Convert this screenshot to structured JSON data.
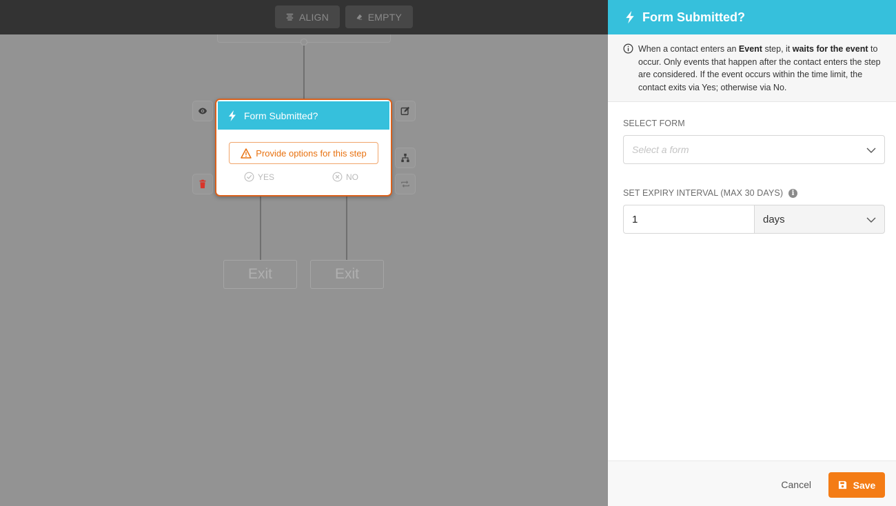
{
  "toolbar": {
    "align_label": "ALIGN",
    "empty_label": "EMPTY"
  },
  "step_card": {
    "title": "Form Submitted?",
    "warning": "Provide options for this step",
    "yes_label": "YES",
    "no_label": "NO"
  },
  "exits": [
    "Exit",
    "Exit"
  ],
  "panel": {
    "title": "Form Submitted?",
    "info": {
      "t1": "When a contact enters an ",
      "b1": "Event",
      "t2": " step, it ",
      "b2": "waits for the event",
      "t3": " to occur. Only events that happen after the contact enters the step are considered. If the event occurs within the time limit, the contact exits via Yes; otherwise via No."
    },
    "select_form": {
      "label": "SELECT FORM",
      "placeholder": "Select a form"
    },
    "expiry": {
      "label": "SET EXPIRY INTERVAL (MAX 30 DAYS)",
      "value": "1",
      "unit": "days"
    },
    "footer": {
      "cancel_label": "Cancel",
      "save_label": "Save"
    }
  },
  "colors": {
    "accent_cyan": "#36c0dc",
    "accent_orange": "#f47c15",
    "card_border": "#d8601c",
    "warning_text": "#e8710f",
    "delete_red": "#d9342b"
  },
  "icons": {
    "toolbar": [
      "align-icon",
      "eraser-icon"
    ],
    "step_side": [
      "eye-icon",
      "edit-icon",
      "sitemap-icon",
      "trash-icon",
      "repeat-icon"
    ],
    "step": [
      "bolt-icon",
      "warning-icon",
      "check-circle-icon",
      "x-circle-icon"
    ],
    "panel": [
      "bolt-icon",
      "info-circle-icon",
      "chevron-down-icon",
      "save-disk-icon"
    ]
  }
}
